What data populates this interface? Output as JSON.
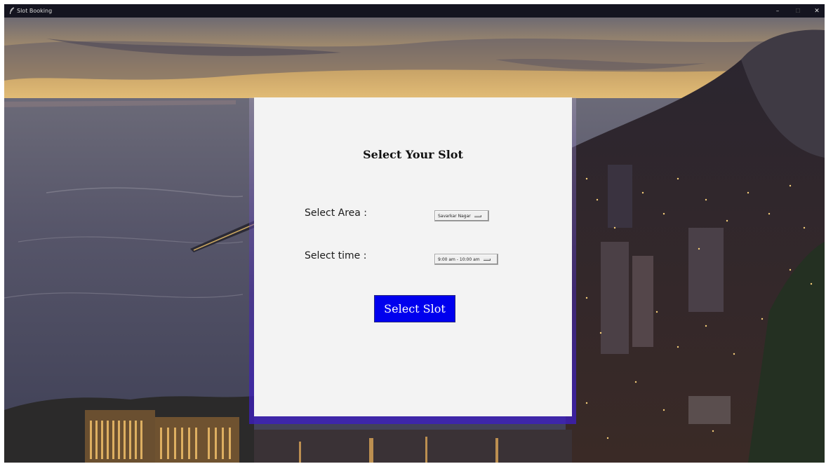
{
  "window": {
    "title": "Slot Booking",
    "minimize_glyph": "–",
    "maximize_glyph": "☐",
    "close_glyph": "✕"
  },
  "form": {
    "heading": "Select Your Slot",
    "area_label": "Select Area :",
    "area_value": "Savarkar Nagar",
    "time_label": "Select time :",
    "time_value": "9:00 am - 10:00 am",
    "submit_label": "Select Slot"
  },
  "colors": {
    "button": "#0000ee",
    "panel": "#f3f3f3",
    "titlebar": "#141420"
  },
  "icons": {
    "app": "feather-icon",
    "dropdown": "option-menu-indicator"
  }
}
